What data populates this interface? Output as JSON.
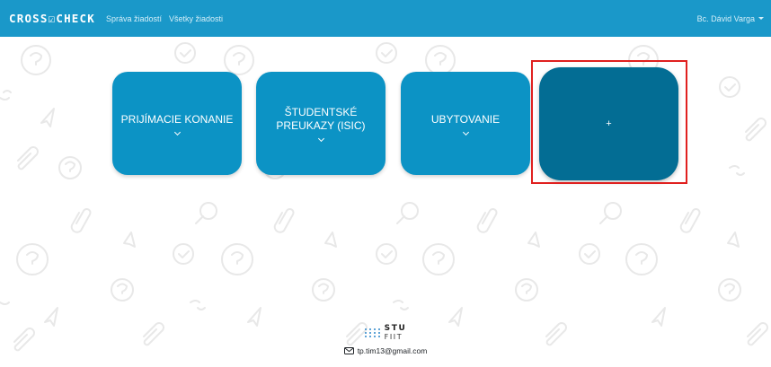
{
  "navbar": {
    "brand": "CROSS☑CHECK",
    "links": [
      "Správa žiadostí",
      "Všetky žiadosti"
    ],
    "user": "Bc. Dávid Varga"
  },
  "cards": [
    {
      "label": "PRIJÍMACIE KONANIE"
    },
    {
      "label": "ŠTUDENTSKÉ PREUKAZY (ISIC)"
    },
    {
      "label": "UBYTOVANIE"
    },
    {
      "label": "+"
    }
  ],
  "footer": {
    "logo_top": "STU",
    "logo_bottom": "FIIT",
    "email": "tp.tim13@gmail.com"
  },
  "colors": {
    "navbar": "#1a98c9",
    "card": "#0c93c5",
    "card_add": "#036d94",
    "highlight": "#e0201f"
  }
}
